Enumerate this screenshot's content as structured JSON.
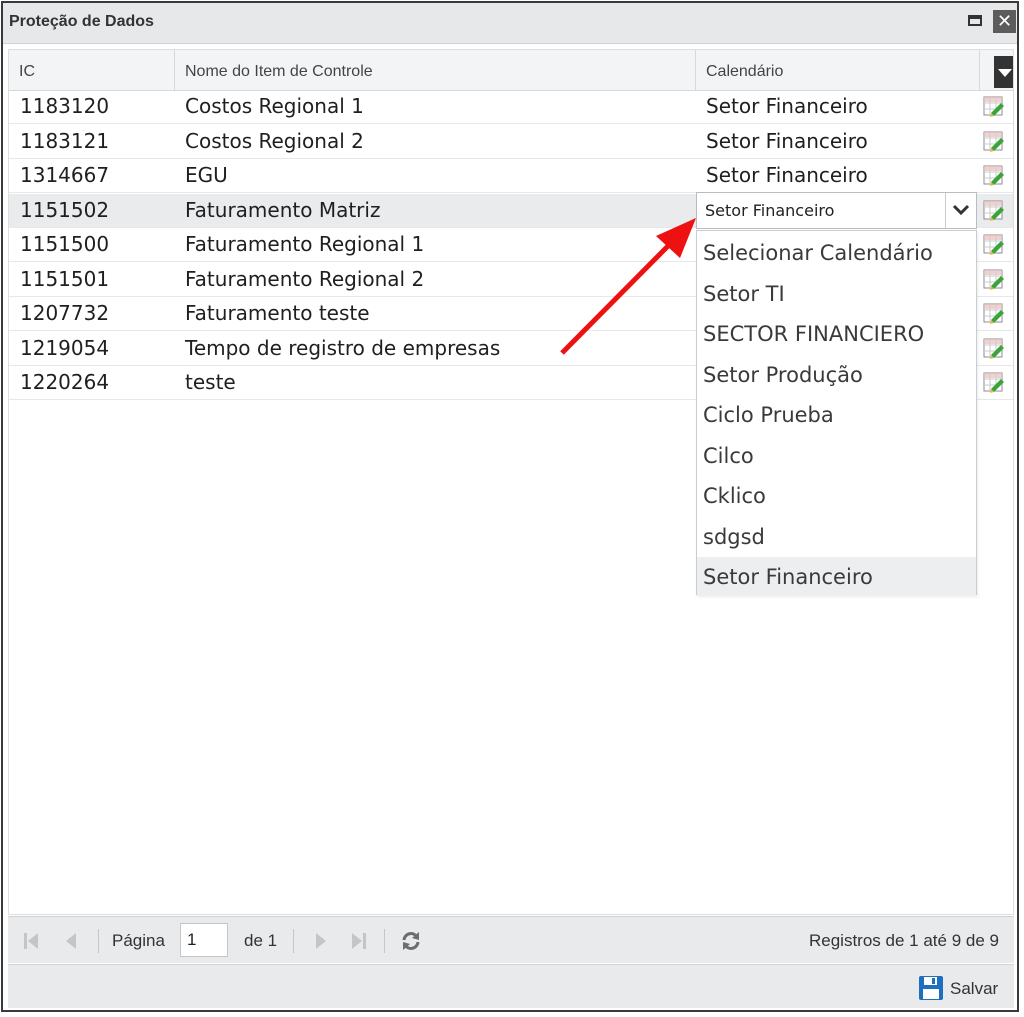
{
  "window": {
    "title": "Proteção de Dados"
  },
  "grid": {
    "columns": [
      "IC",
      "Nome do Item de Controle",
      "Calendário"
    ],
    "rows": [
      {
        "ic": "1183120",
        "name": "Costos Regional 1",
        "calendar": "Setor Financeiro"
      },
      {
        "ic": "1183121",
        "name": "Costos Regional 2",
        "calendar": "Setor Financeiro"
      },
      {
        "ic": "1314667",
        "name": "EGU",
        "calendar": "Setor Financeiro"
      },
      {
        "ic": "1151502",
        "name": "Faturamento Matriz",
        "calendar": ""
      },
      {
        "ic": "1151500",
        "name": "Faturamento Regional 1",
        "calendar": ""
      },
      {
        "ic": "1151501",
        "name": "Faturamento Regional 2",
        "calendar": ""
      },
      {
        "ic": "1207732",
        "name": "Faturamento teste",
        "calendar": ""
      },
      {
        "ic": "1219054",
        "name": "Tempo de registro de empresas",
        "calendar": ""
      },
      {
        "ic": "1220264",
        "name": "teste",
        "calendar": ""
      }
    ]
  },
  "calendar_select": {
    "value": "Setor Financeiro",
    "options": [
      "Selecionar Calendário",
      "Setor TI",
      "SECTOR FINANCIERO",
      "Setor Produção",
      "Ciclo Prueba",
      "Cilco",
      "Cklico",
      "sdgsd",
      "Setor Financeiro"
    ]
  },
  "pager": {
    "page_label": "Página",
    "page_value": "1",
    "of_label": "de 1",
    "records": "Registros de 1 até 9 de 9"
  },
  "footer": {
    "save_label": "Salvar"
  },
  "colors": {
    "annotation_arrow": "#ee1111",
    "save_icon": "#1e6fbf"
  }
}
